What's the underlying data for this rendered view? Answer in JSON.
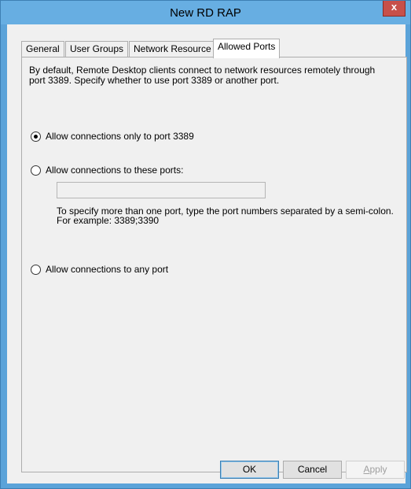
{
  "window": {
    "title": "New RD RAP",
    "close_label": "x"
  },
  "tabs": [
    {
      "label": "General"
    },
    {
      "label": "User Groups"
    },
    {
      "label": "Network Resource"
    },
    {
      "label": "Allowed Ports"
    }
  ],
  "active_tab": "Allowed Ports",
  "panel": {
    "description_line1": "By default, Remote Desktop clients connect to network resources remotely through",
    "description_line2": "port 3389. Specify whether to use port 3389 or another port.",
    "options": [
      {
        "label": "Allow connections only to port 3389",
        "checked": true
      },
      {
        "label": "Allow connections to these ports:",
        "checked": false
      },
      {
        "label": "Allow connections to any port",
        "checked": false
      }
    ],
    "ports_input": {
      "value": ""
    },
    "hint_line1": "To specify more than one port, type the port numbers separated by a semi-colon.",
    "hint_line2": "For example: 3389;3390"
  },
  "buttons": {
    "ok": "OK",
    "cancel": "Cancel",
    "apply_mnemonic": "A",
    "apply_rest": "pply"
  },
  "colors": {
    "title_bar": "#67aee2",
    "close_button": "#c7504a",
    "dialog_background": "#f0f0f0"
  }
}
